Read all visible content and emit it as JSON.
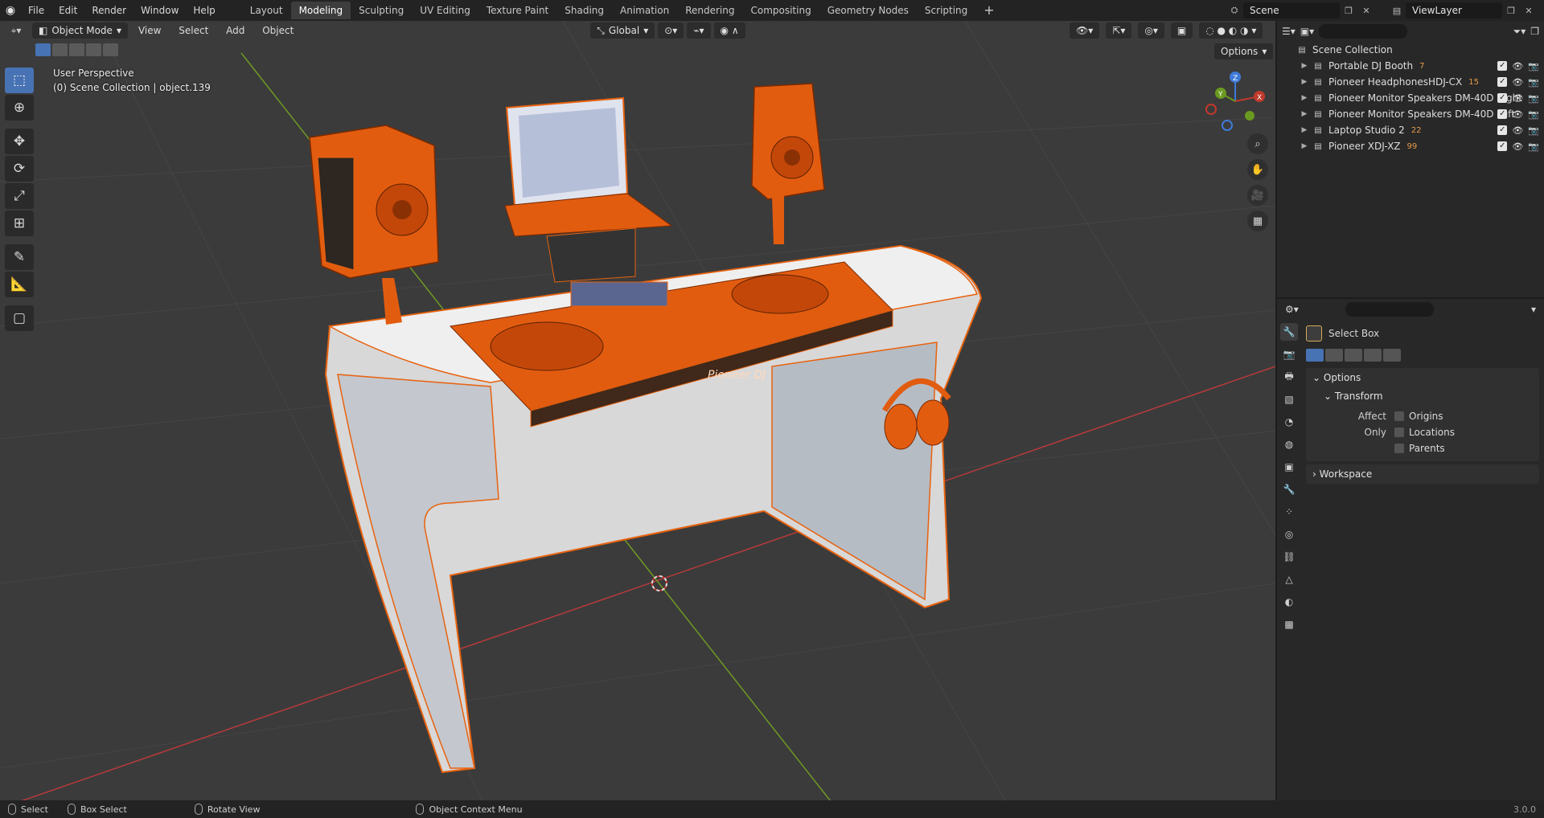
{
  "topbar": {
    "menus": [
      "File",
      "Edit",
      "Render",
      "Window",
      "Help"
    ],
    "workspaces": [
      "Layout",
      "Modeling",
      "Sculpting",
      "UV Editing",
      "Texture Paint",
      "Shading",
      "Animation",
      "Rendering",
      "Compositing",
      "Geometry Nodes",
      "Scripting"
    ],
    "active_workspace": "Modeling",
    "plus": "+",
    "scene": "Scene",
    "view_layer": "ViewLayer"
  },
  "viewport": {
    "mode": "Object Mode",
    "menus": [
      "View",
      "Select",
      "Add",
      "Object"
    ],
    "orientation": "Global",
    "options": "Options",
    "perspective": "User Perspective",
    "context": "(0) Scene Collection | object.139",
    "gizmo": {
      "x": "X",
      "y": "Y",
      "z": "Z"
    },
    "brand": "Pioneer DJ"
  },
  "outliner": {
    "search_placeholder": "",
    "root": "Scene Collection",
    "items": [
      {
        "label": "Portable DJ Booth",
        "count": "7"
      },
      {
        "label": "Pioneer HeadphonesHDJ-CX",
        "count": "15"
      },
      {
        "label": "Pioneer Monitor Speakers DM-40D Right",
        "count": ""
      },
      {
        "label": "Pioneer Monitor Speakers DM-40D Left",
        "count": ""
      },
      {
        "label": "Laptop Studio 2",
        "count": "22"
      },
      {
        "label": "Pioneer XDJ-XZ",
        "count": "99"
      }
    ]
  },
  "properties": {
    "tool": "Select Box",
    "options": "Options",
    "transform": "Transform",
    "affect_only": "Affect Only",
    "checks": [
      "Origins",
      "Locations",
      "Parents"
    ],
    "workspace": "Workspace"
  },
  "statusbar": {
    "select": "Select",
    "box_select": "Box Select",
    "rotate_view": "Rotate View",
    "context_menu": "Object Context Menu",
    "version": "3.0.0"
  },
  "colors": {
    "accent": "#4772b3",
    "selection": "#e8620f",
    "x_axis": "#c0392b",
    "y_axis": "#6a9a1f",
    "z_axis": "#3f7ad8"
  }
}
